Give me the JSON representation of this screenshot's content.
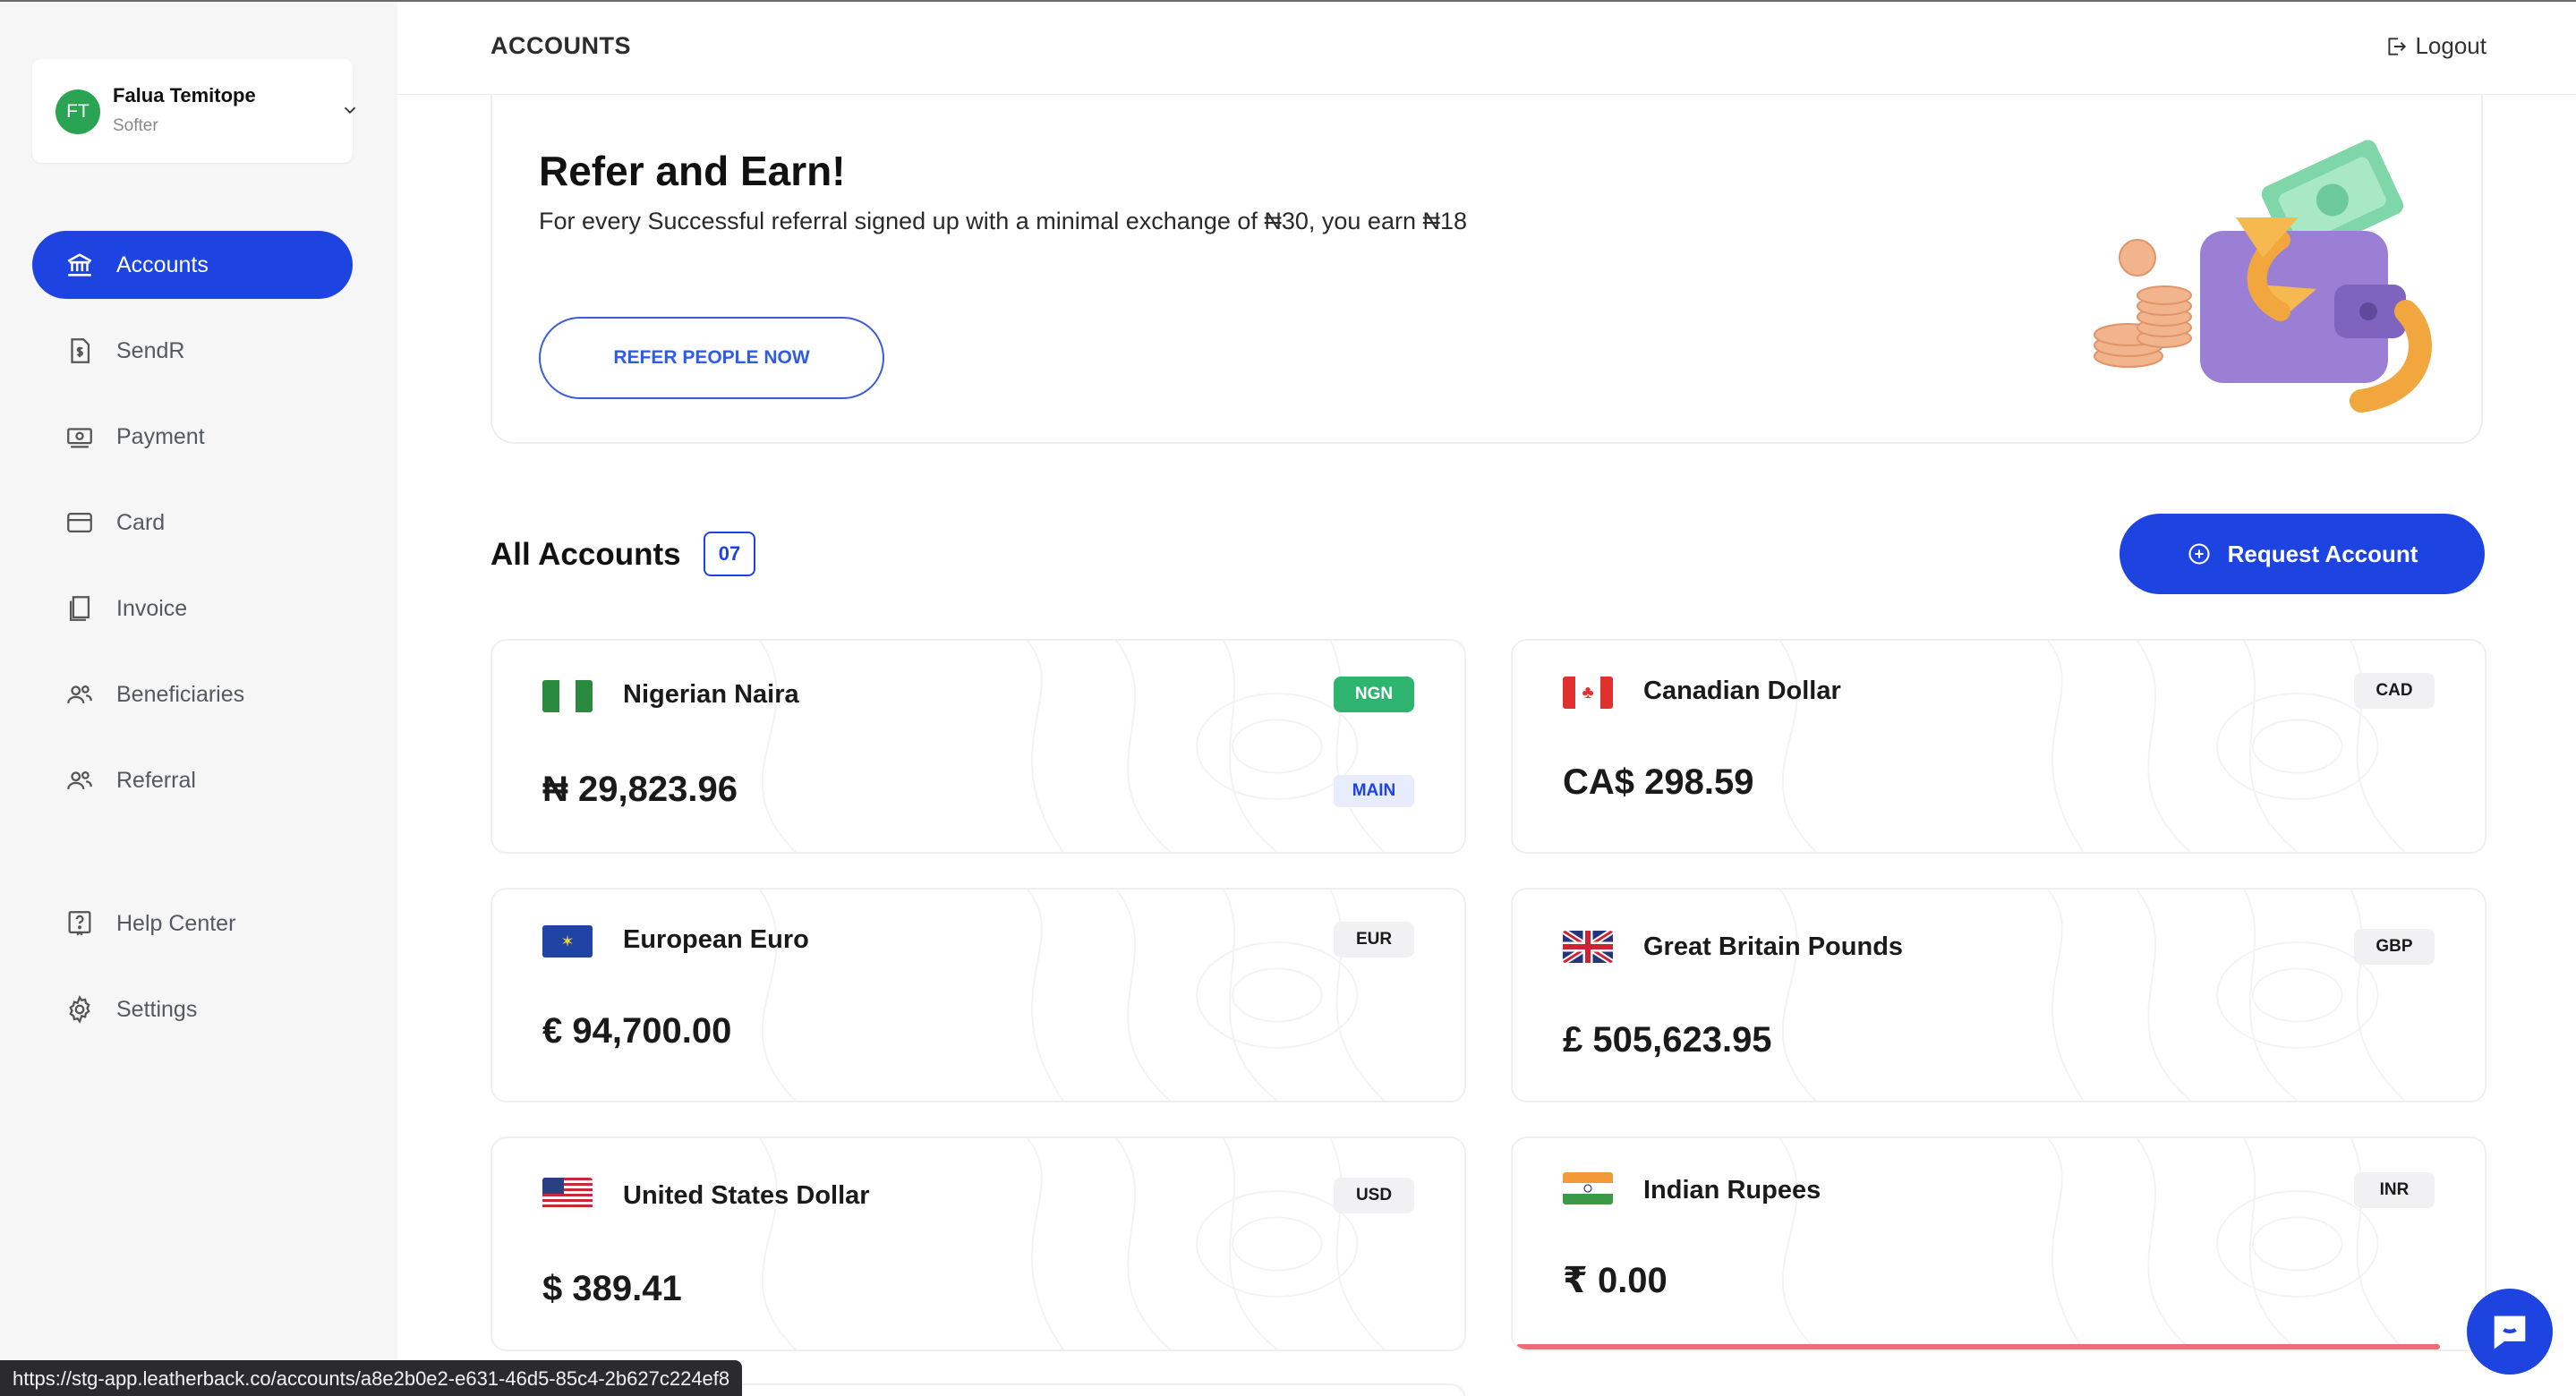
{
  "profile": {
    "initials": "FT",
    "name": "Falua Temitope",
    "company": "Softer"
  },
  "nav": [
    {
      "label": "Accounts",
      "icon": "bank-icon",
      "active": true
    },
    {
      "label": "SendR",
      "icon": "document-dollar-icon"
    },
    {
      "label": "Payment",
      "icon": "cash-icon"
    },
    {
      "label": "Card",
      "icon": "credit-card-icon"
    },
    {
      "label": "Invoice",
      "icon": "invoice-icon"
    },
    {
      "label": "Beneficiaries",
      "icon": "users-icon"
    },
    {
      "label": "Referral",
      "icon": "users-icon"
    },
    {
      "label": "Help Center",
      "icon": "help-icon"
    },
    {
      "label": "Settings",
      "icon": "gear-icon"
    }
  ],
  "header": {
    "title": "ACCOUNTS",
    "logout": "Logout"
  },
  "referral": {
    "title": "Refer and Earn!",
    "subtitle": "For every Successful referral signed up with a minimal exchange of ₦30, you earn ₦18",
    "button": "REFER PEOPLE NOW"
  },
  "accounts": {
    "title": "All Accounts",
    "count": "07",
    "request_button": "Request Account",
    "items": [
      {
        "name": "Nigerian Naira",
        "code": "NGN",
        "balance": "₦ 29,823.96",
        "tag": "MAIN",
        "flag": "ng"
      },
      {
        "name": "Canadian Dollar",
        "code": "CAD",
        "balance": "CA$ 298.59",
        "flag": "ca"
      },
      {
        "name": "European Euro",
        "code": "EUR",
        "balance": "€ 94,700.00",
        "flag": "eu"
      },
      {
        "name": "Great Britain Pounds",
        "code": "GBP",
        "balance": "£ 505,623.95",
        "flag": "gb"
      },
      {
        "name": "United States Dollar",
        "code": "USD",
        "balance": "$ 389.41",
        "flag": "us"
      },
      {
        "name": "Indian Rupees",
        "code": "INR",
        "balance": "₹ 0.00",
        "flag": "in",
        "progress": 0.95
      }
    ]
  },
  "status_url": "https://stg-app.leatherback.co/accounts/a8e2b0e2-e631-46d5-85c4-2b627c224ef8",
  "colors": {
    "primary": "#1d43e0",
    "ngn_badge": "#2db56f",
    "progress": "#f06b73"
  }
}
